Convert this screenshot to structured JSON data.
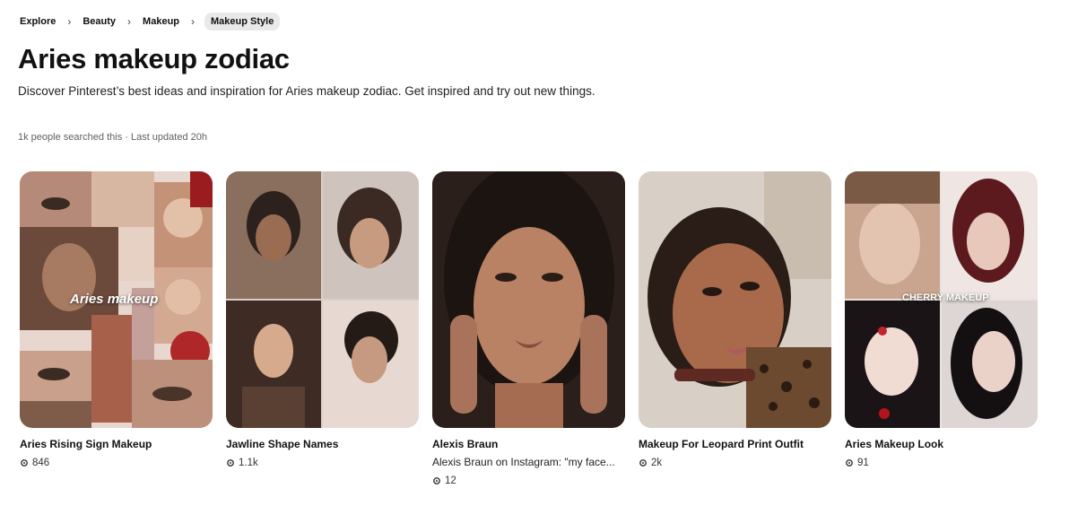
{
  "breadcrumb": {
    "items": [
      "Explore",
      "Beauty",
      "Makeup"
    ],
    "current": "Makeup Style"
  },
  "header": {
    "title": "Aries makeup zodiac",
    "description": "Discover Pinterest’s best ideas and inspiration for Aries makeup zodiac. Get inspired and try out new things.",
    "meta": "1k people searched this · Last updated 20h"
  },
  "pins": [
    {
      "title": "Aries Rising Sign Makeup",
      "subtitle": "",
      "count": "846",
      "overlay": "Aries makeup",
      "icon": "reaction-icon"
    },
    {
      "title": "Jawline Shape Names",
      "subtitle": "",
      "count": "1.1k",
      "overlay": "",
      "icon": "reaction-icon"
    },
    {
      "title": "Alexis Braun",
      "subtitle": "Alexis Braun on Instagram: \"my face...",
      "count": "12",
      "overlay": "",
      "icon": "reaction-icon"
    },
    {
      "title": "Makeup For Leopard Print Outfit",
      "subtitle": "",
      "count": "2k",
      "overlay": "",
      "icon": "reaction-icon"
    },
    {
      "title": "Aries Makeup Look",
      "subtitle": "",
      "count": "91",
      "overlay": "CHERRY MAKEUP",
      "icon": "reaction-icon"
    }
  ],
  "colors": {
    "breadcrumb_current_bg": "#e9e9e9",
    "meta_text": "#5f5f5f"
  }
}
